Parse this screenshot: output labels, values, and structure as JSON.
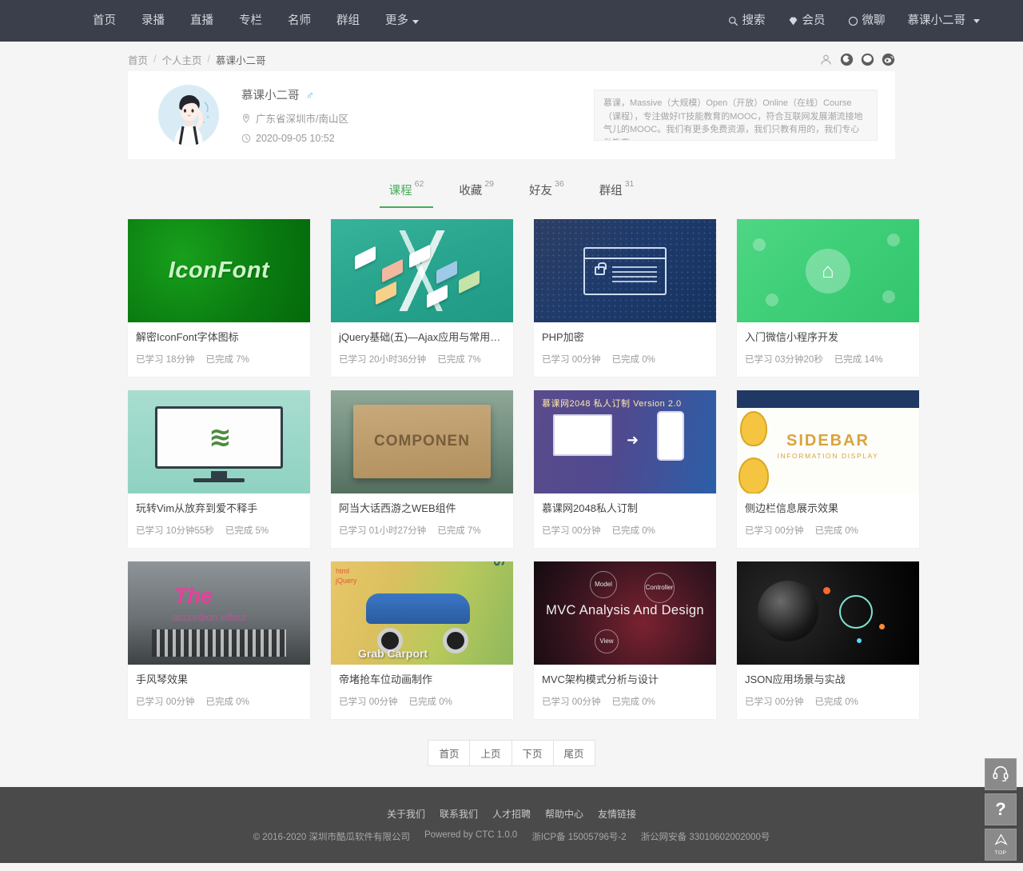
{
  "navbar": {
    "menu": [
      {
        "label": "首页"
      },
      {
        "label": "录播"
      },
      {
        "label": "直播"
      },
      {
        "label": "专栏"
      },
      {
        "label": "名师"
      },
      {
        "label": "群组"
      },
      {
        "label": "更多"
      }
    ],
    "right": [
      {
        "label": "搜索",
        "icon": "search-icon"
      },
      {
        "label": "会员",
        "icon": "diamond-icon"
      },
      {
        "label": "微聊",
        "icon": "chat-circle-icon"
      }
    ],
    "user": "慕课小二哥",
    "bg_color": "#3a3f4b"
  },
  "breadcrumb": {
    "home": "首页",
    "section": "个人主页",
    "current": "慕课小二哥",
    "separator": "/"
  },
  "share_icons": [
    {
      "name": "person-icon"
    },
    {
      "name": "qq-icon"
    },
    {
      "name": "wechat-icon"
    },
    {
      "name": "weibo-icon"
    }
  ],
  "profile": {
    "name": "慕课小二哥",
    "gender_symbol": "♂",
    "location": "广东省深圳市/南山区",
    "joined": "2020-09-05 10:52",
    "intro": "慕课，Massive（大规模）Open（开放）Online（在线）Course（课程），专注做好IT技能教育的MOOC，符合互联网发展潮流接地气儿的MOOC。我们有更多免费资源，我们只教有用的，我们专心做教育。"
  },
  "tabs": [
    {
      "label": "课程",
      "count": "62",
      "active": true
    },
    {
      "label": "收藏",
      "count": "29",
      "active": false
    },
    {
      "label": "好友",
      "count": "36",
      "active": false
    },
    {
      "label": "群组",
      "count": "31",
      "active": false
    }
  ],
  "tab_accent_color": "#47ad5a",
  "courses": [
    {
      "title": "解密IconFont字体图标",
      "studied": "已学习 18分钟",
      "progress": "已完成 7%",
      "thumb_text": "IconFont"
    },
    {
      "title": "jQuery基础(五)—Ajax应用与常用插件",
      "studied": "已学习 20小时36分钟",
      "progress": "已完成 7%",
      "thumb_text": ""
    },
    {
      "title": "PHP加密",
      "studied": "已学习 00分钟",
      "progress": "已完成 0%",
      "thumb_text": ""
    },
    {
      "title": "入门微信小程序开发",
      "studied": "已学习 03分钟20秒",
      "progress": "已完成 14%",
      "thumb_text": ""
    },
    {
      "title": "玩转Vim从放弃到爱不释手",
      "studied": "已学习 10分钟55秒",
      "progress": "已完成 5%",
      "thumb_text": ""
    },
    {
      "title": "阿当大话西游之WEB组件",
      "studied": "已学习 01小时27分钟",
      "progress": "已完成 7%",
      "thumb_text": "COMPONEN"
    },
    {
      "title": "慕课网2048私人订制",
      "studied": "已学习 00分钟",
      "progress": "已完成 0%",
      "thumb_text": "慕课网2048 私人订制 Version 2.0"
    },
    {
      "title": "侧边栏信息展示效果",
      "studied": "已学习 00分钟",
      "progress": "已完成 0%",
      "thumb_text": "SIDEBAR",
      "thumb_sub": "INFORMATION DISPLAY"
    },
    {
      "title": "手风琴效果",
      "studied": "已学习 00分钟",
      "progress": "已完成 0%",
      "thumb_text": "The",
      "thumb_sub": "accordion effect"
    },
    {
      "title": "帝堵抢车位动画制作",
      "studied": "已学习 00分钟",
      "progress": "已完成 0%",
      "thumb_text": "Grab  Carport"
    },
    {
      "title": "MVC架构模式分析与设计",
      "studied": "已学习 00分钟",
      "progress": "已完成 0%",
      "thumb_text": "MVC Analysis And Design"
    },
    {
      "title": "JSON应用场景与实战",
      "studied": "已学习 00分钟",
      "progress": "已完成 0%",
      "thumb_text": ""
    }
  ],
  "pagination": [
    {
      "label": "首页"
    },
    {
      "label": "上页"
    },
    {
      "label": "下页"
    },
    {
      "label": "尾页"
    }
  ],
  "footer": {
    "links": [
      "关于我们",
      "联系我们",
      "人才招聘",
      "帮助中心",
      "友情链接"
    ],
    "copyright": "© 2016-2020 深圳市酷瓜软件有限公司",
    "powered": "Powered by CTC 1.0.0",
    "icp": "浙ICP备 15005796号-2",
    "police": "浙公网安备 33010602002000号"
  },
  "floaters": [
    {
      "name": "headset-icon",
      "label": ""
    },
    {
      "name": "help-icon",
      "label": "?"
    },
    {
      "name": "top-icon",
      "label": "TOP"
    }
  ]
}
